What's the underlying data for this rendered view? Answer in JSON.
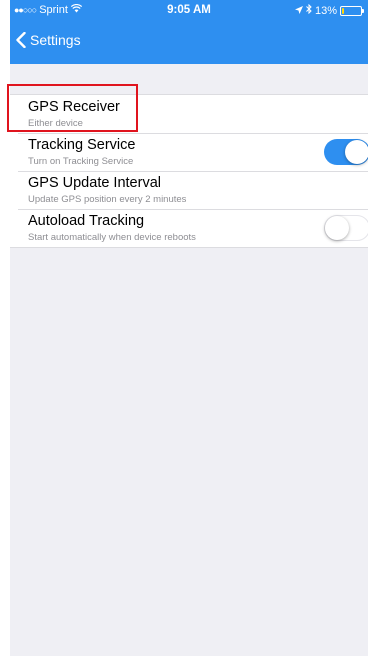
{
  "status_bar": {
    "carrier": "Sprint",
    "time": "9:05 AM",
    "battery": "13%",
    "battery_level": 0.13
  },
  "nav": {
    "back_label": "Settings"
  },
  "settings": [
    {
      "title": "GPS Receiver",
      "subtitle": "Either device"
    },
    {
      "title": "Tracking Service",
      "subtitle": "Turn on Tracking Service",
      "toggle_on": true
    },
    {
      "title": "GPS Update Interval",
      "subtitle": "Update GPS position every 2 minutes"
    },
    {
      "title": "Autoload Tracking",
      "subtitle": "Start automatically when device reboots",
      "toggle_on": false
    }
  ],
  "colors": {
    "accent": "#2e8ff0",
    "highlight": "#e0141e",
    "battery": "#ffd60a"
  },
  "icons": [
    "signal-dots-icon",
    "wifi-icon",
    "location-arrow-icon",
    "bluetooth-icon",
    "battery-icon",
    "chevron-left-icon"
  ]
}
